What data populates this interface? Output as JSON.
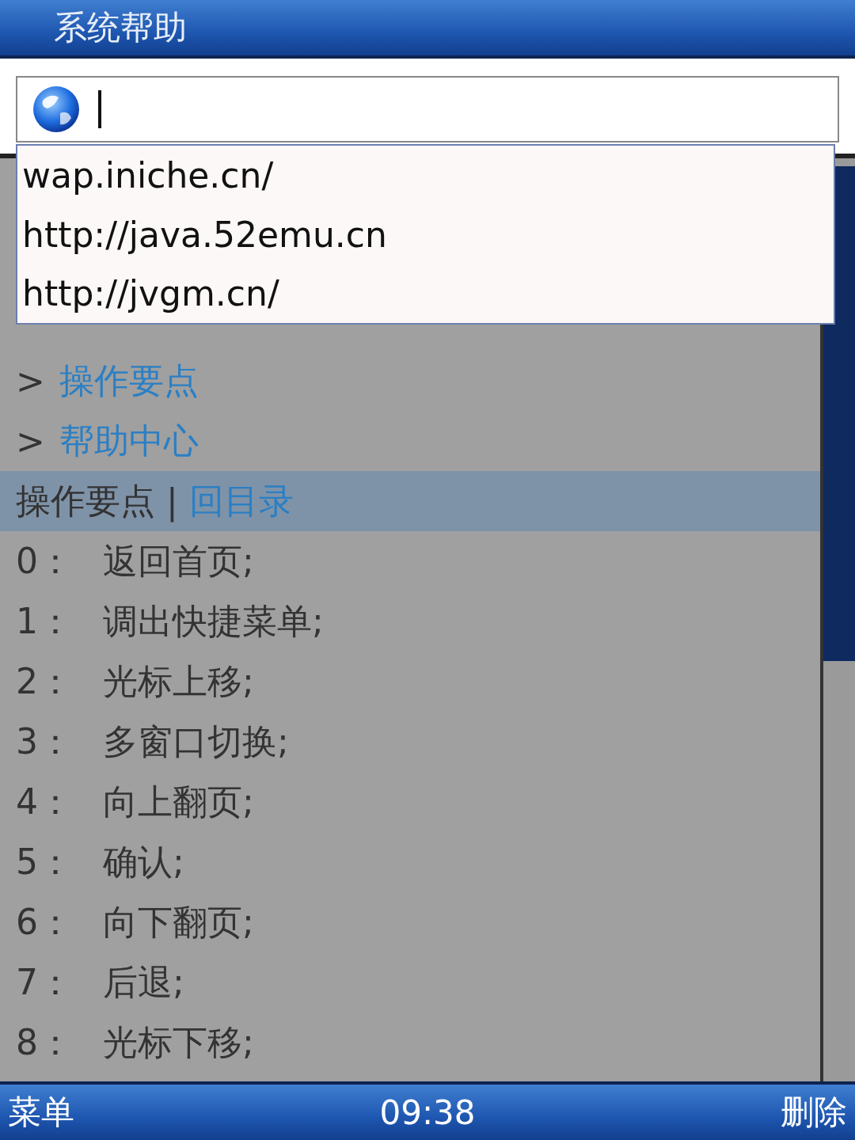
{
  "title": "系统帮助",
  "suggestions": [
    {
      "text": "wap.iniche.cn/"
    },
    {
      "text": "http://java.52emu.cn"
    },
    {
      "text": "http://jvgm.cn/"
    }
  ],
  "links": [
    {
      "marker": ">",
      "label": "操作要点"
    },
    {
      "marker": ">",
      "label": "帮助中心"
    }
  ],
  "section_header": {
    "title": "操作要点",
    "separator": "|",
    "link": "回目录"
  },
  "shortcuts": [
    {
      "key": "0：",
      "action": "返回首页;"
    },
    {
      "key": "1：",
      "action": "调出快捷菜单;"
    },
    {
      "key": "2：",
      "action": "光标上移;"
    },
    {
      "key": "3：",
      "action": "多窗口切换;"
    },
    {
      "key": "4：",
      "action": "向上翻页;"
    },
    {
      "key": "5：",
      "action": "确认;"
    },
    {
      "key": "6：",
      "action": "向下翻页;"
    },
    {
      "key": "7：",
      "action": "后退;"
    },
    {
      "key": "8：",
      "action": "光标下移;"
    }
  ],
  "softkeys": {
    "left": "菜单",
    "clock": "09:38",
    "right": "删除"
  }
}
